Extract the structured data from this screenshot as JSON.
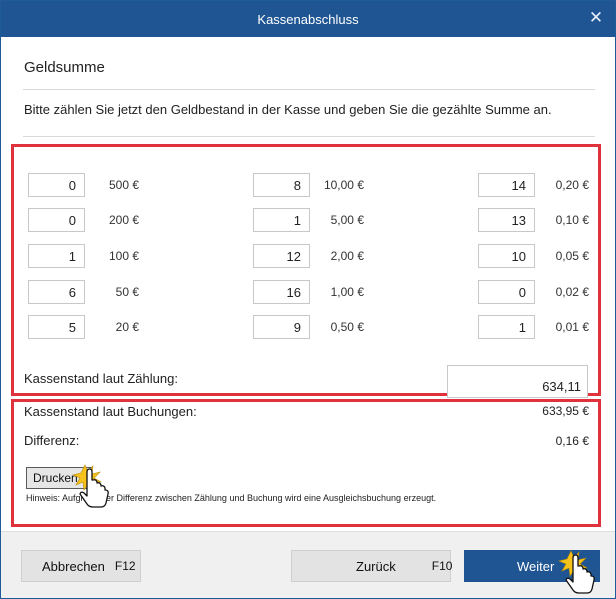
{
  "window": {
    "title": "Kassenabschluss",
    "close_glyph": "✕"
  },
  "section_title": "Geldsumme",
  "intro": "Bitte zählen Sie jetzt den Geldbestand in der Kasse und geben Sie die gezählte Summe an.",
  "denominations": {
    "col1": [
      {
        "count": "0",
        "label": "500 €"
      },
      {
        "count": "0",
        "label": "200 €"
      },
      {
        "count": "1",
        "label": "100 €"
      },
      {
        "count": "6",
        "label": "50 €"
      },
      {
        "count": "5",
        "label": "20 €"
      }
    ],
    "col2": [
      {
        "count": "8",
        "label": "10,00 €"
      },
      {
        "count": "1",
        "label": "5,00 €"
      },
      {
        "count": "12",
        "label": "2,00 €"
      },
      {
        "count": "16",
        "label": "1,00 €"
      },
      {
        "count": "9",
        "label": "0,50 €"
      }
    ],
    "col3": [
      {
        "count": "14",
        "label": "0,20 €"
      },
      {
        "count": "13",
        "label": "0,10 €"
      },
      {
        "count": "10",
        "label": "0,05 €"
      },
      {
        "count": "0",
        "label": "0,02 €"
      },
      {
        "count": "1",
        "label": "0,01 €"
      }
    ]
  },
  "count_total": {
    "label": "Kassenstand laut Zählung:",
    "value": "634,11"
  },
  "booking_total": {
    "label": "Kassenstand laut Buchungen:",
    "value": "633,95 €"
  },
  "difference": {
    "label": "Differenz:",
    "value": "0,16 €"
  },
  "print_button": "Drucken",
  "hint": "Hinweis: Aufgrund der Differenz zwischen Zählung und Buchung wird eine Ausgleichsbuchung erzeugt.",
  "footer": {
    "cancel": {
      "label": "Abbrechen",
      "shortcut": "F12"
    },
    "back": {
      "label": "Zurück",
      "shortcut": "F10"
    },
    "next": {
      "label": "Weiter"
    }
  },
  "colors": {
    "titlebar": "#1f5593",
    "highlight": "#e0323c",
    "primary_button": "#1f5593"
  }
}
